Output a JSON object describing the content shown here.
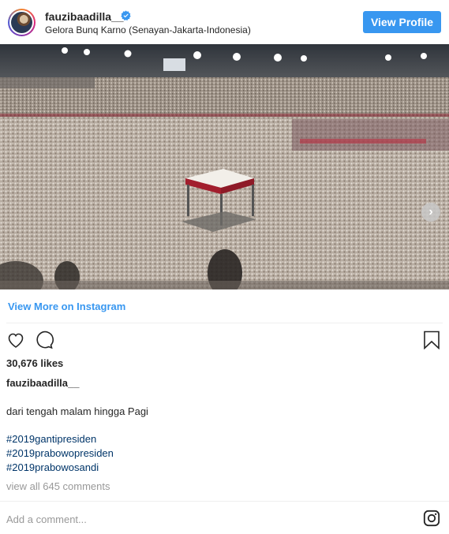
{
  "header": {
    "username": "fauzibaadilla__",
    "location": "Gelora Bunq Karno (Senayan-Jakarta-Indonesia)",
    "view_profile_label": "View Profile"
  },
  "photo": {
    "next_label": "›"
  },
  "links": {
    "view_more": "View More on Instagram"
  },
  "stats": {
    "likes": "30,676 likes"
  },
  "caption": {
    "username": "fauzibaadilla__",
    "text": "dari tengah malam hingga Pagi",
    "hashtags": [
      "#2019gantipresiden",
      "#2019prabowopresiden",
      "#2019prabowosandi"
    ]
  },
  "comments": {
    "view_all": "view all 645 comments",
    "add_placeholder": "Add a comment..."
  },
  "colors": {
    "accent": "#3897f0",
    "hashtag": "#003569",
    "muted": "#999999"
  }
}
